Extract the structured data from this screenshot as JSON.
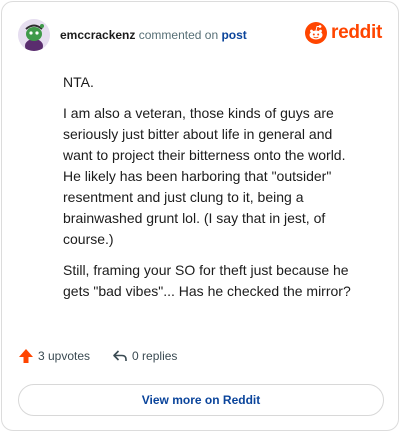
{
  "header": {
    "username": "emccrackenz",
    "action_text": "commented on",
    "post_link": "post",
    "brand_name": "reddit"
  },
  "comment": {
    "paragraphs": [
      "NTA.",
      "I am also a veteran, those kinds of guys are seriously just bitter about life in general and want to project their bitterness onto the world. He likely has been harboring that \"outsider\" resentment and just clung to it, being a brainwashed grunt lol. (I say that in jest, of course.)",
      "Still, framing your SO for theft just because he gets \"bad vibes\"... Has he checked the mirror?"
    ]
  },
  "stats": {
    "upvotes": "3 upvotes",
    "replies": "0 replies"
  },
  "footer": {
    "view_more_label": "View more on Reddit"
  },
  "colors": {
    "brand": "#ff4500",
    "link": "#0a449b"
  },
  "icons": {
    "avatar": "snoo-avatar",
    "brand": "reddit-logo-icon",
    "upvote": "upvote-arrow-icon",
    "reply": "reply-arrow-icon"
  }
}
